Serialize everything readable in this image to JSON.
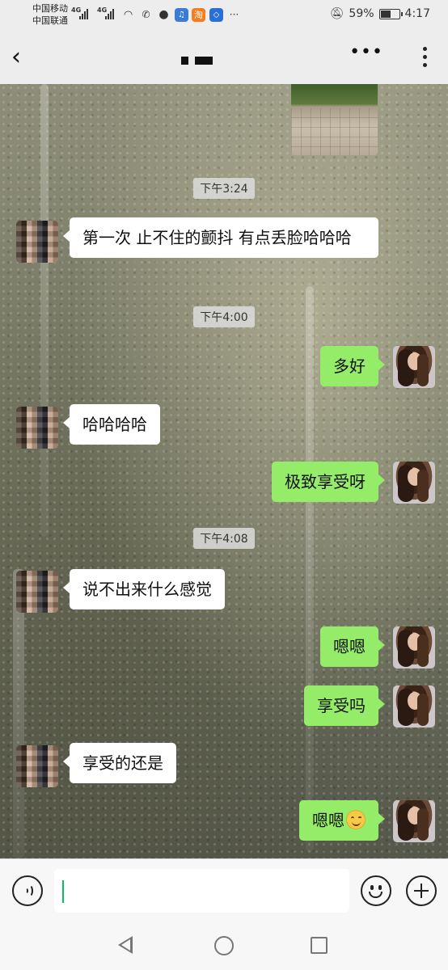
{
  "status_bar": {
    "carrier1": "中国移动",
    "carrier2": "中国联通",
    "net1": "4G",
    "net2": "4G",
    "battery_text": "59%",
    "battery_level": 0.59,
    "time": "4:17",
    "app_icon_taobao": "淘"
  },
  "header": {
    "back_icon": "chevron-left-icon",
    "title": "",
    "more_icon": "more-horizontal-icon",
    "menu_icon": "more-vertical-icon"
  },
  "chat": {
    "timestamps": [
      "下午3:24",
      "下午4:00",
      "下午4:08"
    ],
    "messages": [
      {
        "side": "in",
        "text": "第一次 止不住的颤抖 有点丢脸哈哈哈"
      },
      {
        "side": "out",
        "text": "多好"
      },
      {
        "side": "in",
        "text": "哈哈哈哈"
      },
      {
        "side": "out",
        "text": "极致享受呀"
      },
      {
        "side": "in",
        "text": "说不出来什么感觉"
      },
      {
        "side": "out",
        "text": "嗯嗯"
      },
      {
        "side": "out",
        "text": "享受吗"
      },
      {
        "side": "in",
        "text": "享受的还是"
      },
      {
        "side": "out",
        "text": "嗯嗯",
        "emoji": "smiling-face-icon"
      }
    ]
  },
  "input_bar": {
    "voice_icon": "voice-icon",
    "input_value": "",
    "emoji_icon": "emoji-icon",
    "plus_icon": "plus-icon"
  },
  "nav_bar": {
    "back_icon": "triangle-back-icon",
    "home_icon": "circle-home-icon",
    "recent_icon": "square-recent-icon"
  }
}
